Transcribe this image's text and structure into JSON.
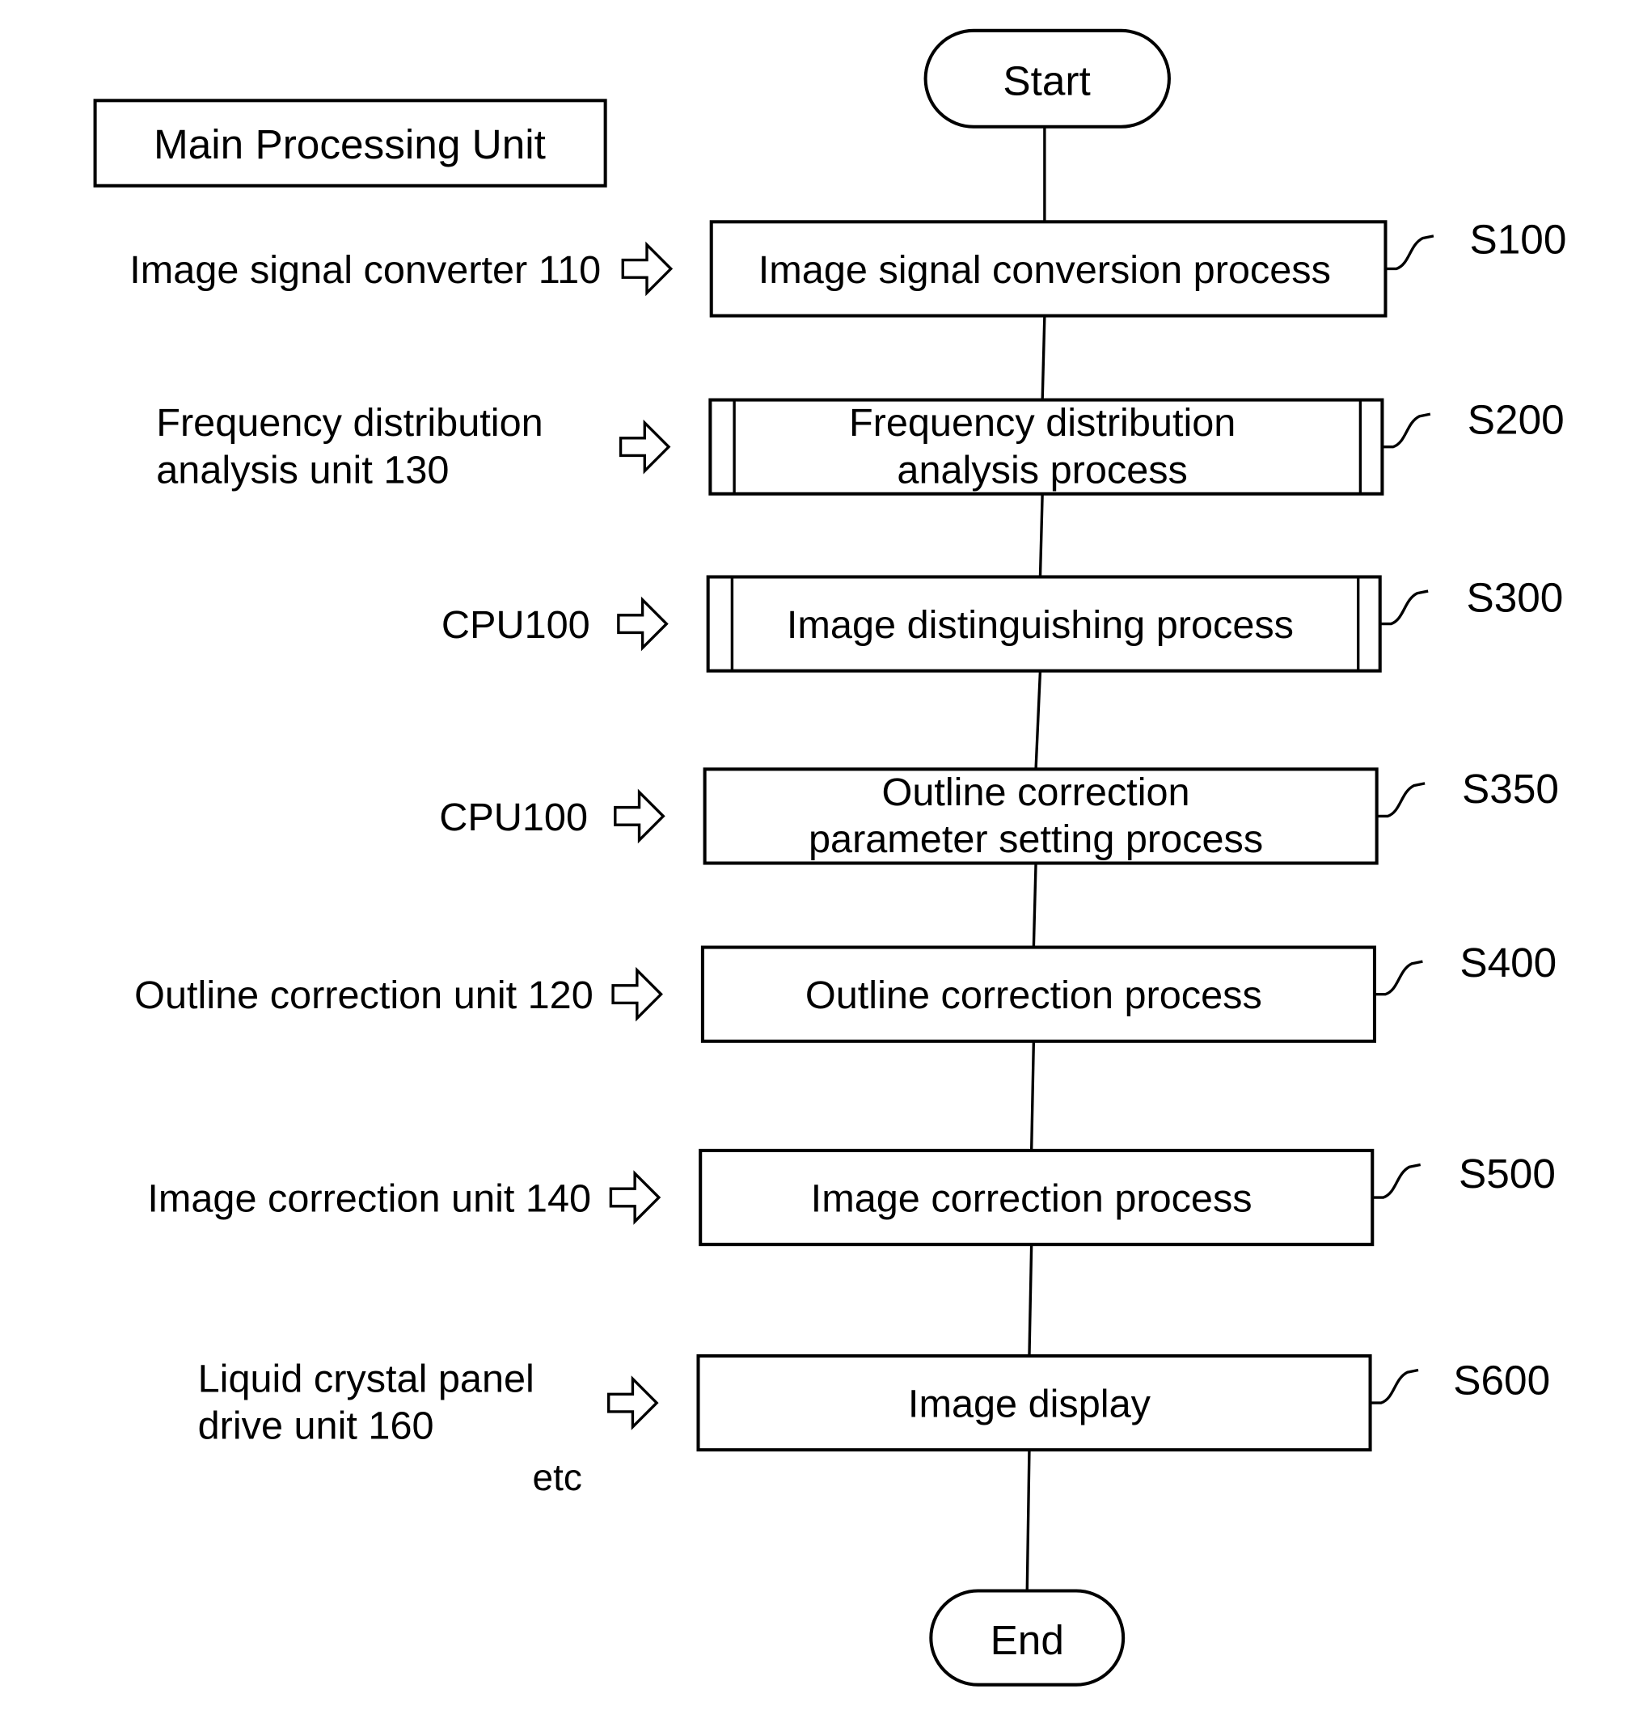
{
  "header": {
    "title": "Main Processing Unit"
  },
  "terminals": {
    "start": "Start",
    "end": "End"
  },
  "steps": [
    {
      "id": "S100",
      "label_lines": [
        "Image signal conversion process"
      ],
      "type": "process",
      "unit_lines": [
        "Image signal converter 110"
      ]
    },
    {
      "id": "S200",
      "label_lines": [
        "Frequency distribution",
        "analysis process"
      ],
      "type": "predefined-process",
      "unit_lines": [
        "Frequency distribution",
        "analysis unit 130"
      ]
    },
    {
      "id": "S300",
      "label_lines": [
        "Image distinguishing process"
      ],
      "type": "predefined-process",
      "unit_lines": [
        "CPU100"
      ]
    },
    {
      "id": "S350",
      "label_lines": [
        "Outline correction",
        "parameter setting process"
      ],
      "type": "process",
      "unit_lines": [
        "CPU100"
      ]
    },
    {
      "id": "S400",
      "label_lines": [
        "Outline correction process"
      ],
      "type": "process",
      "unit_lines": [
        "Outline correction unit 120"
      ]
    },
    {
      "id": "S500",
      "label_lines": [
        "Image correction process"
      ],
      "type": "process",
      "unit_lines": [
        "Image correction unit 140"
      ]
    },
    {
      "id": "S600",
      "label_lines": [
        "Image display"
      ],
      "type": "process",
      "unit_lines": [
        "Liquid crystal panel",
        "drive unit 160"
      ]
    }
  ],
  "footnote": "etc"
}
